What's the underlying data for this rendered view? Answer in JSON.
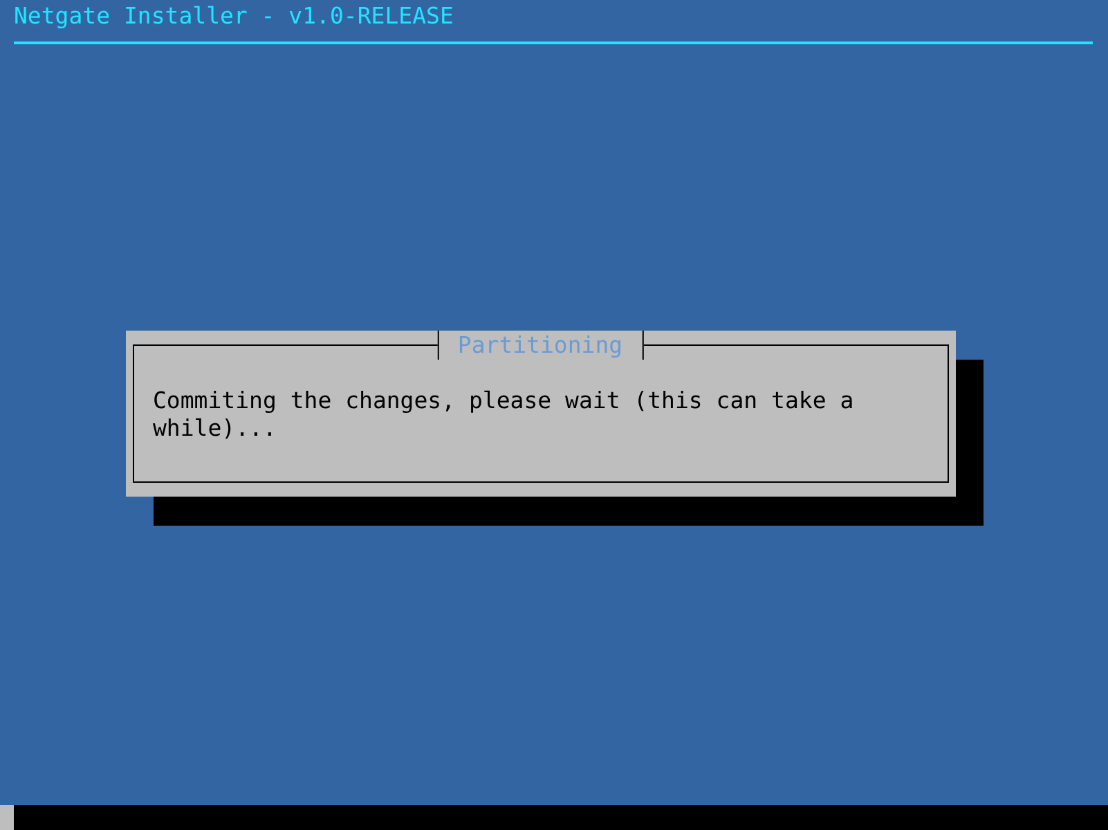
{
  "header": {
    "title": "Netgate Installer - v1.0-RELEASE"
  },
  "dialog": {
    "title": "Partitioning",
    "message": "Commiting the changes, please wait (this can take a while)..."
  }
}
